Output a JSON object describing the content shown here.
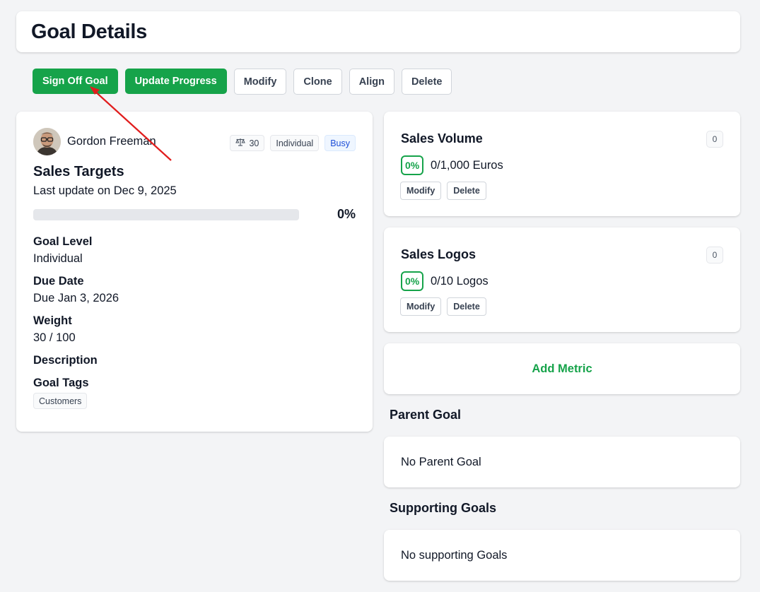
{
  "header": {
    "title": "Goal Details"
  },
  "toolbar": {
    "sign_off": "Sign Off Goal",
    "update_progress": "Update Progress",
    "modify": "Modify",
    "clone": "Clone",
    "align": "Align",
    "delete": "Delete"
  },
  "goal": {
    "owner_name": "Gordon Freeman",
    "weight_badge": "30",
    "weight_icon": "scale-icon",
    "level_badge": "Individual",
    "status_badge": "Busy",
    "title": "Sales Targets",
    "last_update": "Last update on Dec 9, 2025",
    "progress": 0,
    "progress_label": "0%",
    "fields": {
      "level_label": "Goal Level",
      "level_value": "Individual",
      "due_label": "Due Date",
      "due_value": "Due Jan 3, 2026",
      "weight_label": "Weight",
      "weight_value": "30 / 100",
      "description_label": "Description",
      "tags_label": "Goal Tags"
    },
    "tags": [
      "Customers"
    ]
  },
  "metrics": [
    {
      "title": "Sales Volume",
      "count": "0",
      "pct": "0%",
      "value": "0/1,000 Euros",
      "modify": "Modify",
      "delete": "Delete"
    },
    {
      "title": "Sales Logos",
      "count": "0",
      "pct": "0%",
      "value": "0/10 Logos",
      "modify": "Modify",
      "delete": "Delete"
    }
  ],
  "add_metric": "Add Metric",
  "parent_goal": {
    "heading": "Parent Goal",
    "empty": "No Parent Goal"
  },
  "supporting_goals": {
    "heading": "Supporting Goals",
    "empty": "No supporting Goals"
  },
  "colors": {
    "primary": "#16a34a",
    "status_blue": "#1d4ed8",
    "annotation_arrow": "#e11d1d"
  }
}
